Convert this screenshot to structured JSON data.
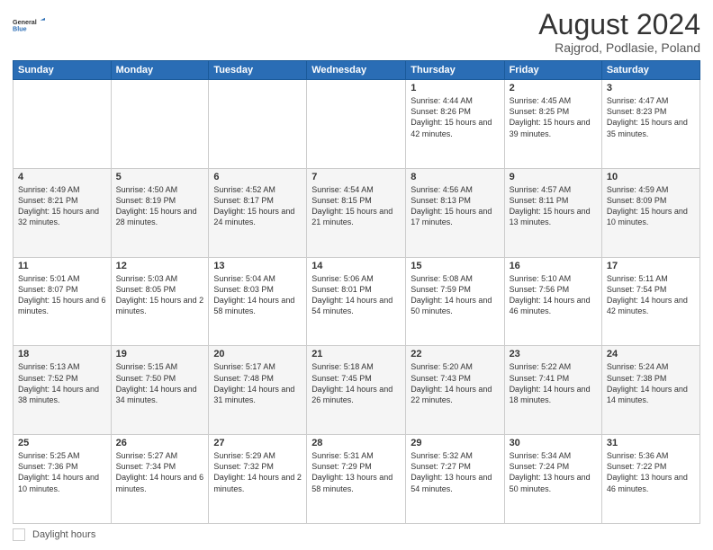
{
  "header": {
    "logo_line1": "General",
    "logo_line2": "Blue",
    "title": "August 2024",
    "subtitle": "Rajgrod, Podlasie, Poland"
  },
  "weekdays": [
    "Sunday",
    "Monday",
    "Tuesday",
    "Wednesday",
    "Thursday",
    "Friday",
    "Saturday"
  ],
  "weeks": [
    [
      {
        "day": "",
        "content": ""
      },
      {
        "day": "",
        "content": ""
      },
      {
        "day": "",
        "content": ""
      },
      {
        "day": "",
        "content": ""
      },
      {
        "day": "1",
        "content": "Sunrise: 4:44 AM\nSunset: 8:26 PM\nDaylight: 15 hours\nand 42 minutes."
      },
      {
        "day": "2",
        "content": "Sunrise: 4:45 AM\nSunset: 8:25 PM\nDaylight: 15 hours\nand 39 minutes."
      },
      {
        "day": "3",
        "content": "Sunrise: 4:47 AM\nSunset: 8:23 PM\nDaylight: 15 hours\nand 35 minutes."
      }
    ],
    [
      {
        "day": "4",
        "content": "Sunrise: 4:49 AM\nSunset: 8:21 PM\nDaylight: 15 hours\nand 32 minutes."
      },
      {
        "day": "5",
        "content": "Sunrise: 4:50 AM\nSunset: 8:19 PM\nDaylight: 15 hours\nand 28 minutes."
      },
      {
        "day": "6",
        "content": "Sunrise: 4:52 AM\nSunset: 8:17 PM\nDaylight: 15 hours\nand 24 minutes."
      },
      {
        "day": "7",
        "content": "Sunrise: 4:54 AM\nSunset: 8:15 PM\nDaylight: 15 hours\nand 21 minutes."
      },
      {
        "day": "8",
        "content": "Sunrise: 4:56 AM\nSunset: 8:13 PM\nDaylight: 15 hours\nand 17 minutes."
      },
      {
        "day": "9",
        "content": "Sunrise: 4:57 AM\nSunset: 8:11 PM\nDaylight: 15 hours\nand 13 minutes."
      },
      {
        "day": "10",
        "content": "Sunrise: 4:59 AM\nSunset: 8:09 PM\nDaylight: 15 hours\nand 10 minutes."
      }
    ],
    [
      {
        "day": "11",
        "content": "Sunrise: 5:01 AM\nSunset: 8:07 PM\nDaylight: 15 hours\nand 6 minutes."
      },
      {
        "day": "12",
        "content": "Sunrise: 5:03 AM\nSunset: 8:05 PM\nDaylight: 15 hours\nand 2 minutes."
      },
      {
        "day": "13",
        "content": "Sunrise: 5:04 AM\nSunset: 8:03 PM\nDaylight: 14 hours\nand 58 minutes."
      },
      {
        "day": "14",
        "content": "Sunrise: 5:06 AM\nSunset: 8:01 PM\nDaylight: 14 hours\nand 54 minutes."
      },
      {
        "day": "15",
        "content": "Sunrise: 5:08 AM\nSunset: 7:59 PM\nDaylight: 14 hours\nand 50 minutes."
      },
      {
        "day": "16",
        "content": "Sunrise: 5:10 AM\nSunset: 7:56 PM\nDaylight: 14 hours\nand 46 minutes."
      },
      {
        "day": "17",
        "content": "Sunrise: 5:11 AM\nSunset: 7:54 PM\nDaylight: 14 hours\nand 42 minutes."
      }
    ],
    [
      {
        "day": "18",
        "content": "Sunrise: 5:13 AM\nSunset: 7:52 PM\nDaylight: 14 hours\nand 38 minutes."
      },
      {
        "day": "19",
        "content": "Sunrise: 5:15 AM\nSunset: 7:50 PM\nDaylight: 14 hours\nand 34 minutes."
      },
      {
        "day": "20",
        "content": "Sunrise: 5:17 AM\nSunset: 7:48 PM\nDaylight: 14 hours\nand 31 minutes."
      },
      {
        "day": "21",
        "content": "Sunrise: 5:18 AM\nSunset: 7:45 PM\nDaylight: 14 hours\nand 26 minutes."
      },
      {
        "day": "22",
        "content": "Sunrise: 5:20 AM\nSunset: 7:43 PM\nDaylight: 14 hours\nand 22 minutes."
      },
      {
        "day": "23",
        "content": "Sunrise: 5:22 AM\nSunset: 7:41 PM\nDaylight: 14 hours\nand 18 minutes."
      },
      {
        "day": "24",
        "content": "Sunrise: 5:24 AM\nSunset: 7:38 PM\nDaylight: 14 hours\nand 14 minutes."
      }
    ],
    [
      {
        "day": "25",
        "content": "Sunrise: 5:25 AM\nSunset: 7:36 PM\nDaylight: 14 hours\nand 10 minutes."
      },
      {
        "day": "26",
        "content": "Sunrise: 5:27 AM\nSunset: 7:34 PM\nDaylight: 14 hours\nand 6 minutes."
      },
      {
        "day": "27",
        "content": "Sunrise: 5:29 AM\nSunset: 7:32 PM\nDaylight: 14 hours\nand 2 minutes."
      },
      {
        "day": "28",
        "content": "Sunrise: 5:31 AM\nSunset: 7:29 PM\nDaylight: 13 hours\nand 58 minutes."
      },
      {
        "day": "29",
        "content": "Sunrise: 5:32 AM\nSunset: 7:27 PM\nDaylight: 13 hours\nand 54 minutes."
      },
      {
        "day": "30",
        "content": "Sunrise: 5:34 AM\nSunset: 7:24 PM\nDaylight: 13 hours\nand 50 minutes."
      },
      {
        "day": "31",
        "content": "Sunrise: 5:36 AM\nSunset: 7:22 PM\nDaylight: 13 hours\nand 46 minutes."
      }
    ]
  ],
  "footer": {
    "daylight_label": "Daylight hours"
  }
}
